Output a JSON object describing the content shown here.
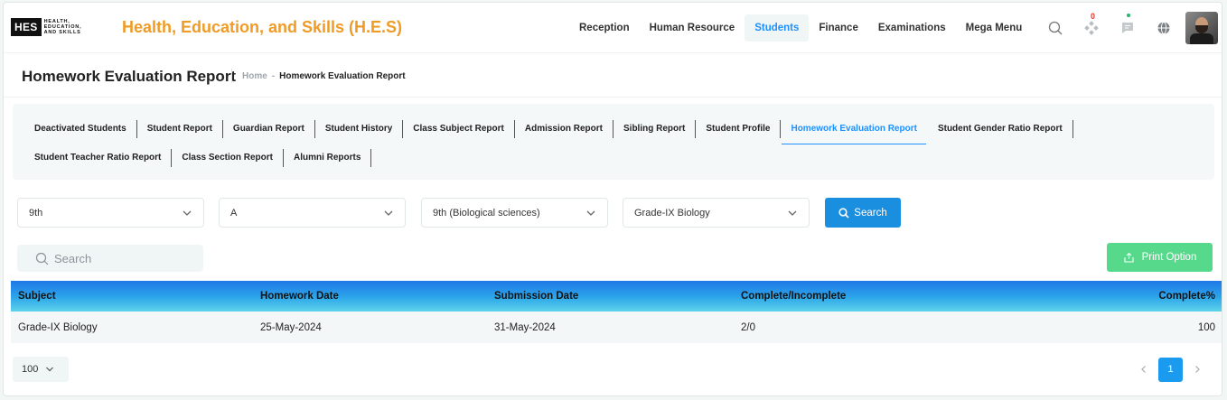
{
  "brand": {
    "logo_text": "HES",
    "logo_sub": [
      "HEALTH,",
      "EDUCATION,",
      "AND SKILLS"
    ],
    "title": "Health, Education, and Skills (H.E.S)"
  },
  "nav": {
    "items": [
      {
        "label": "Reception",
        "active": false
      },
      {
        "label": "Human Resource",
        "active": false
      },
      {
        "label": "Students",
        "active": true
      },
      {
        "label": "Finance",
        "active": false
      },
      {
        "label": "Examinations",
        "active": false
      },
      {
        "label": "Mega Menu",
        "active": false
      }
    ],
    "notification_count": "0"
  },
  "page": {
    "title": "Homework Evaluation Report",
    "breadcrumb_home": "Home",
    "breadcrumb_sep": "-",
    "breadcrumb_current": "Homework Evaluation Report"
  },
  "tabs": {
    "row1": [
      "Deactivated Students",
      "Student Report",
      "Guardian Report",
      "Student History",
      "Class Subject Report",
      "Admission Report",
      "Sibling Report",
      "Student Profile",
      "Homework Evaluation Report",
      "Student Gender Ratio Report"
    ],
    "row2": [
      "Student Teacher Ratio Report",
      "Class Section Report",
      "Alumni Reports"
    ],
    "active": "Homework Evaluation Report"
  },
  "filters": {
    "class": "9th",
    "section": "A",
    "group": "9th (Biological sciences)",
    "subject": "Grade-IX Biology",
    "search_label": "Search"
  },
  "table_search": {
    "placeholder": "Search"
  },
  "print_label": "Print Option",
  "table": {
    "headers": [
      "Subject",
      "Homework Date",
      "Submission Date",
      "Complete/Incomplete",
      "Complete%"
    ],
    "rows": [
      [
        "Grade-IX Biology",
        "25-May-2024",
        "31-May-2024",
        "2/0",
        "100"
      ]
    ]
  },
  "pagination": {
    "page_size": "100",
    "current_page": "1"
  },
  "colors": {
    "brand_orange": "#ef9b26",
    "primary_blue": "#1a8fe0",
    "print_green": "#57d98c"
  }
}
